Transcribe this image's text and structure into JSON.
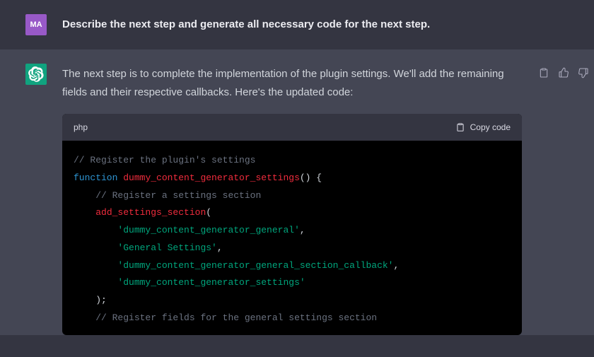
{
  "user": {
    "avatar_initials": "MA",
    "message": "Describe the next step and generate all necessary code for the next step."
  },
  "assistant": {
    "message": "The next step is to complete the implementation of the plugin settings. We'll add the remaining fields and their respective callbacks. Here's the updated code:"
  },
  "actions": {
    "copy_label": "Copy code"
  },
  "code": {
    "language": "php",
    "lines": {
      "c1": "// Register the plugin's settings",
      "kw_function": "function",
      "fn_name": "dummy_content_generator_settings",
      "fn_sig_tail": "() {",
      "c2": "// Register a settings section",
      "call_add_section": "add_settings_section",
      "open_paren": "(",
      "arg1": "'dummy_content_generator_general'",
      "arg2": "'General Settings'",
      "arg3": "'dummy_content_generator_general_section_callback'",
      "arg4": "'dummy_content_generator_settings'",
      "comma": ",",
      "close_call": ");",
      "c3": "// Register fields for the general settings section"
    }
  }
}
